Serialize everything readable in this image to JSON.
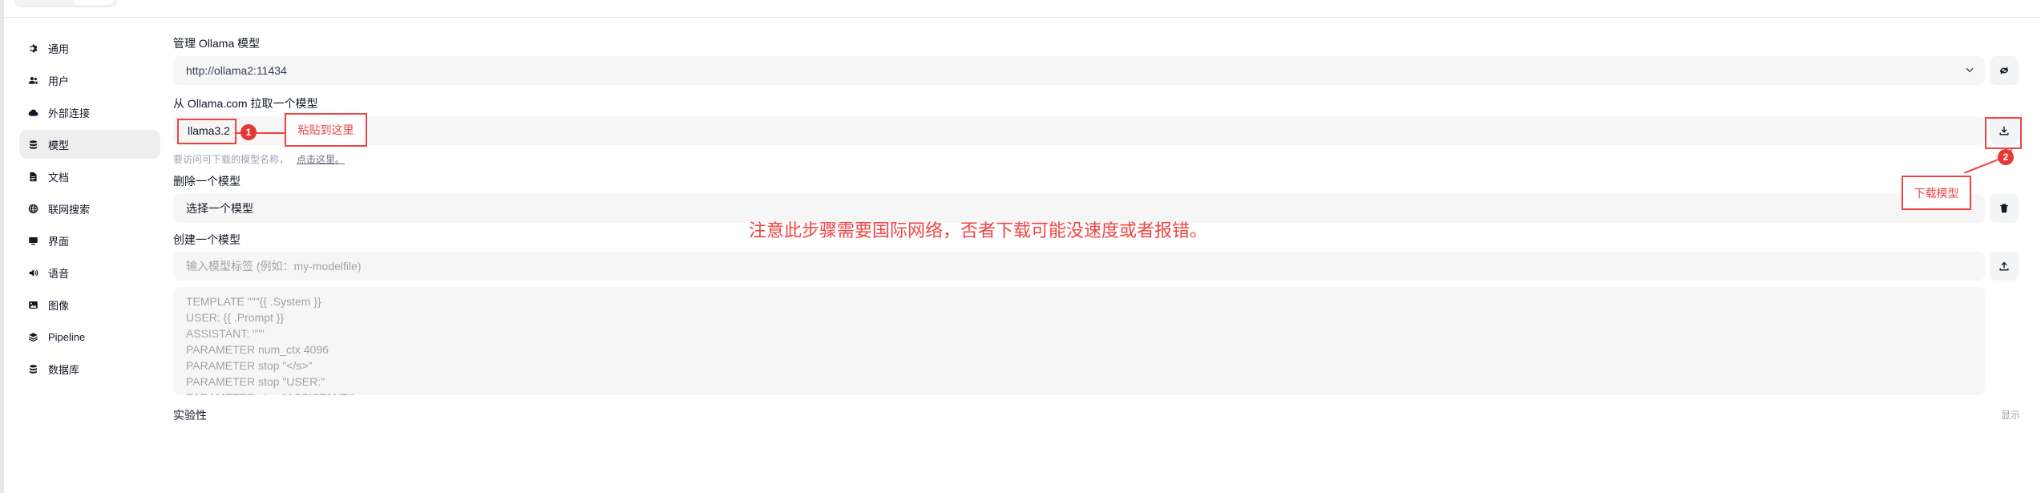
{
  "sidebar": {
    "items": [
      {
        "label": "通用",
        "icon": "gear-icon"
      },
      {
        "label": "用户",
        "icon": "users-icon"
      },
      {
        "label": "外部连接",
        "icon": "cloud-icon"
      },
      {
        "label": "模型",
        "icon": "database-icon",
        "active": true
      },
      {
        "label": "文档",
        "icon": "document-icon"
      },
      {
        "label": "联网搜索",
        "icon": "globe-icon"
      },
      {
        "label": "界面",
        "icon": "monitor-icon"
      },
      {
        "label": "语音",
        "icon": "speaker-icon"
      },
      {
        "label": "图像",
        "icon": "image-icon"
      },
      {
        "label": "Pipeline",
        "icon": "layers-icon"
      },
      {
        "label": "数据库",
        "icon": "database-icon"
      }
    ]
  },
  "manage": {
    "title": "管理 Ollama 模型",
    "url_value": "http://ollama2:11434"
  },
  "pull": {
    "title": "从 Ollama.com 拉取一个模型",
    "input_value": "llama3.2",
    "hint": "要访问可下载的模型名称，",
    "hint_link": "点击这里。"
  },
  "delete": {
    "title": "删除一个模型",
    "select_value": "选择一个模型"
  },
  "create": {
    "title": "创建一个模型",
    "tag_placeholder": "输入模型标签 (例如：my-modelfile)",
    "modelfile_placeholder": "TEMPLATE \"\"\"{{ .System }}\nUSER: {{ .Prompt }}\nASSISTANT: \"\"\"\nPARAMETER num_ctx 4096\nPARAMETER stop \"</s>\"\nPARAMETER stop \"USER:\"\nPARAMETER stop \"ASSISTANT:\""
  },
  "experimental": {
    "title": "实验性",
    "toggle": "显示"
  },
  "annotations": {
    "step1_number": "1",
    "step1_label": "粘贴到这里",
    "step2_number": "2",
    "step2_label": "下载模型",
    "note": "注意此步骤需要国际网络，否者下载可能没速度或者报错。",
    "color": "#ef4444"
  }
}
